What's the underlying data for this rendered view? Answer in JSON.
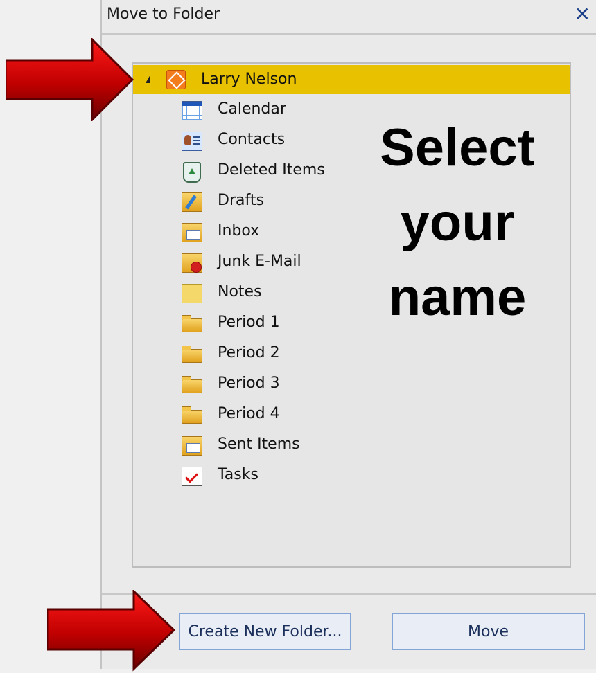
{
  "dialog": {
    "title": "Move to Folder",
    "close_glyph": "✕"
  },
  "tree": {
    "root": {
      "label": "Larry Nelson",
      "icon": "exchange-mailbox-icon"
    },
    "items": [
      {
        "label": "Calendar",
        "icon": "calendar-icon"
      },
      {
        "label": "Contacts",
        "icon": "contacts-icon"
      },
      {
        "label": "Deleted Items",
        "icon": "trash-icon"
      },
      {
        "label": "Drafts",
        "icon": "drafts-icon"
      },
      {
        "label": "Inbox",
        "icon": "inbox-icon"
      },
      {
        "label": "Junk E-Mail",
        "icon": "junk-mail-icon"
      },
      {
        "label": "Notes",
        "icon": "notes-icon"
      },
      {
        "label": "Period 1",
        "icon": "folder-icon"
      },
      {
        "label": "Period 2",
        "icon": "folder-icon"
      },
      {
        "label": "Period 3",
        "icon": "folder-icon"
      },
      {
        "label": "Period 4",
        "icon": "folder-icon"
      },
      {
        "label": "Sent Items",
        "icon": "sent-items-icon"
      },
      {
        "label": "Tasks",
        "icon": "tasks-icon"
      }
    ]
  },
  "overlay": {
    "line1": "Select",
    "line2": "your",
    "line3": "name"
  },
  "buttons": {
    "create_new_folder": "Create New Folder...",
    "move": "Move"
  },
  "colors": {
    "selection": "#e8c200",
    "arrow": "#cc0000",
    "button_border": "#82a4d6"
  }
}
